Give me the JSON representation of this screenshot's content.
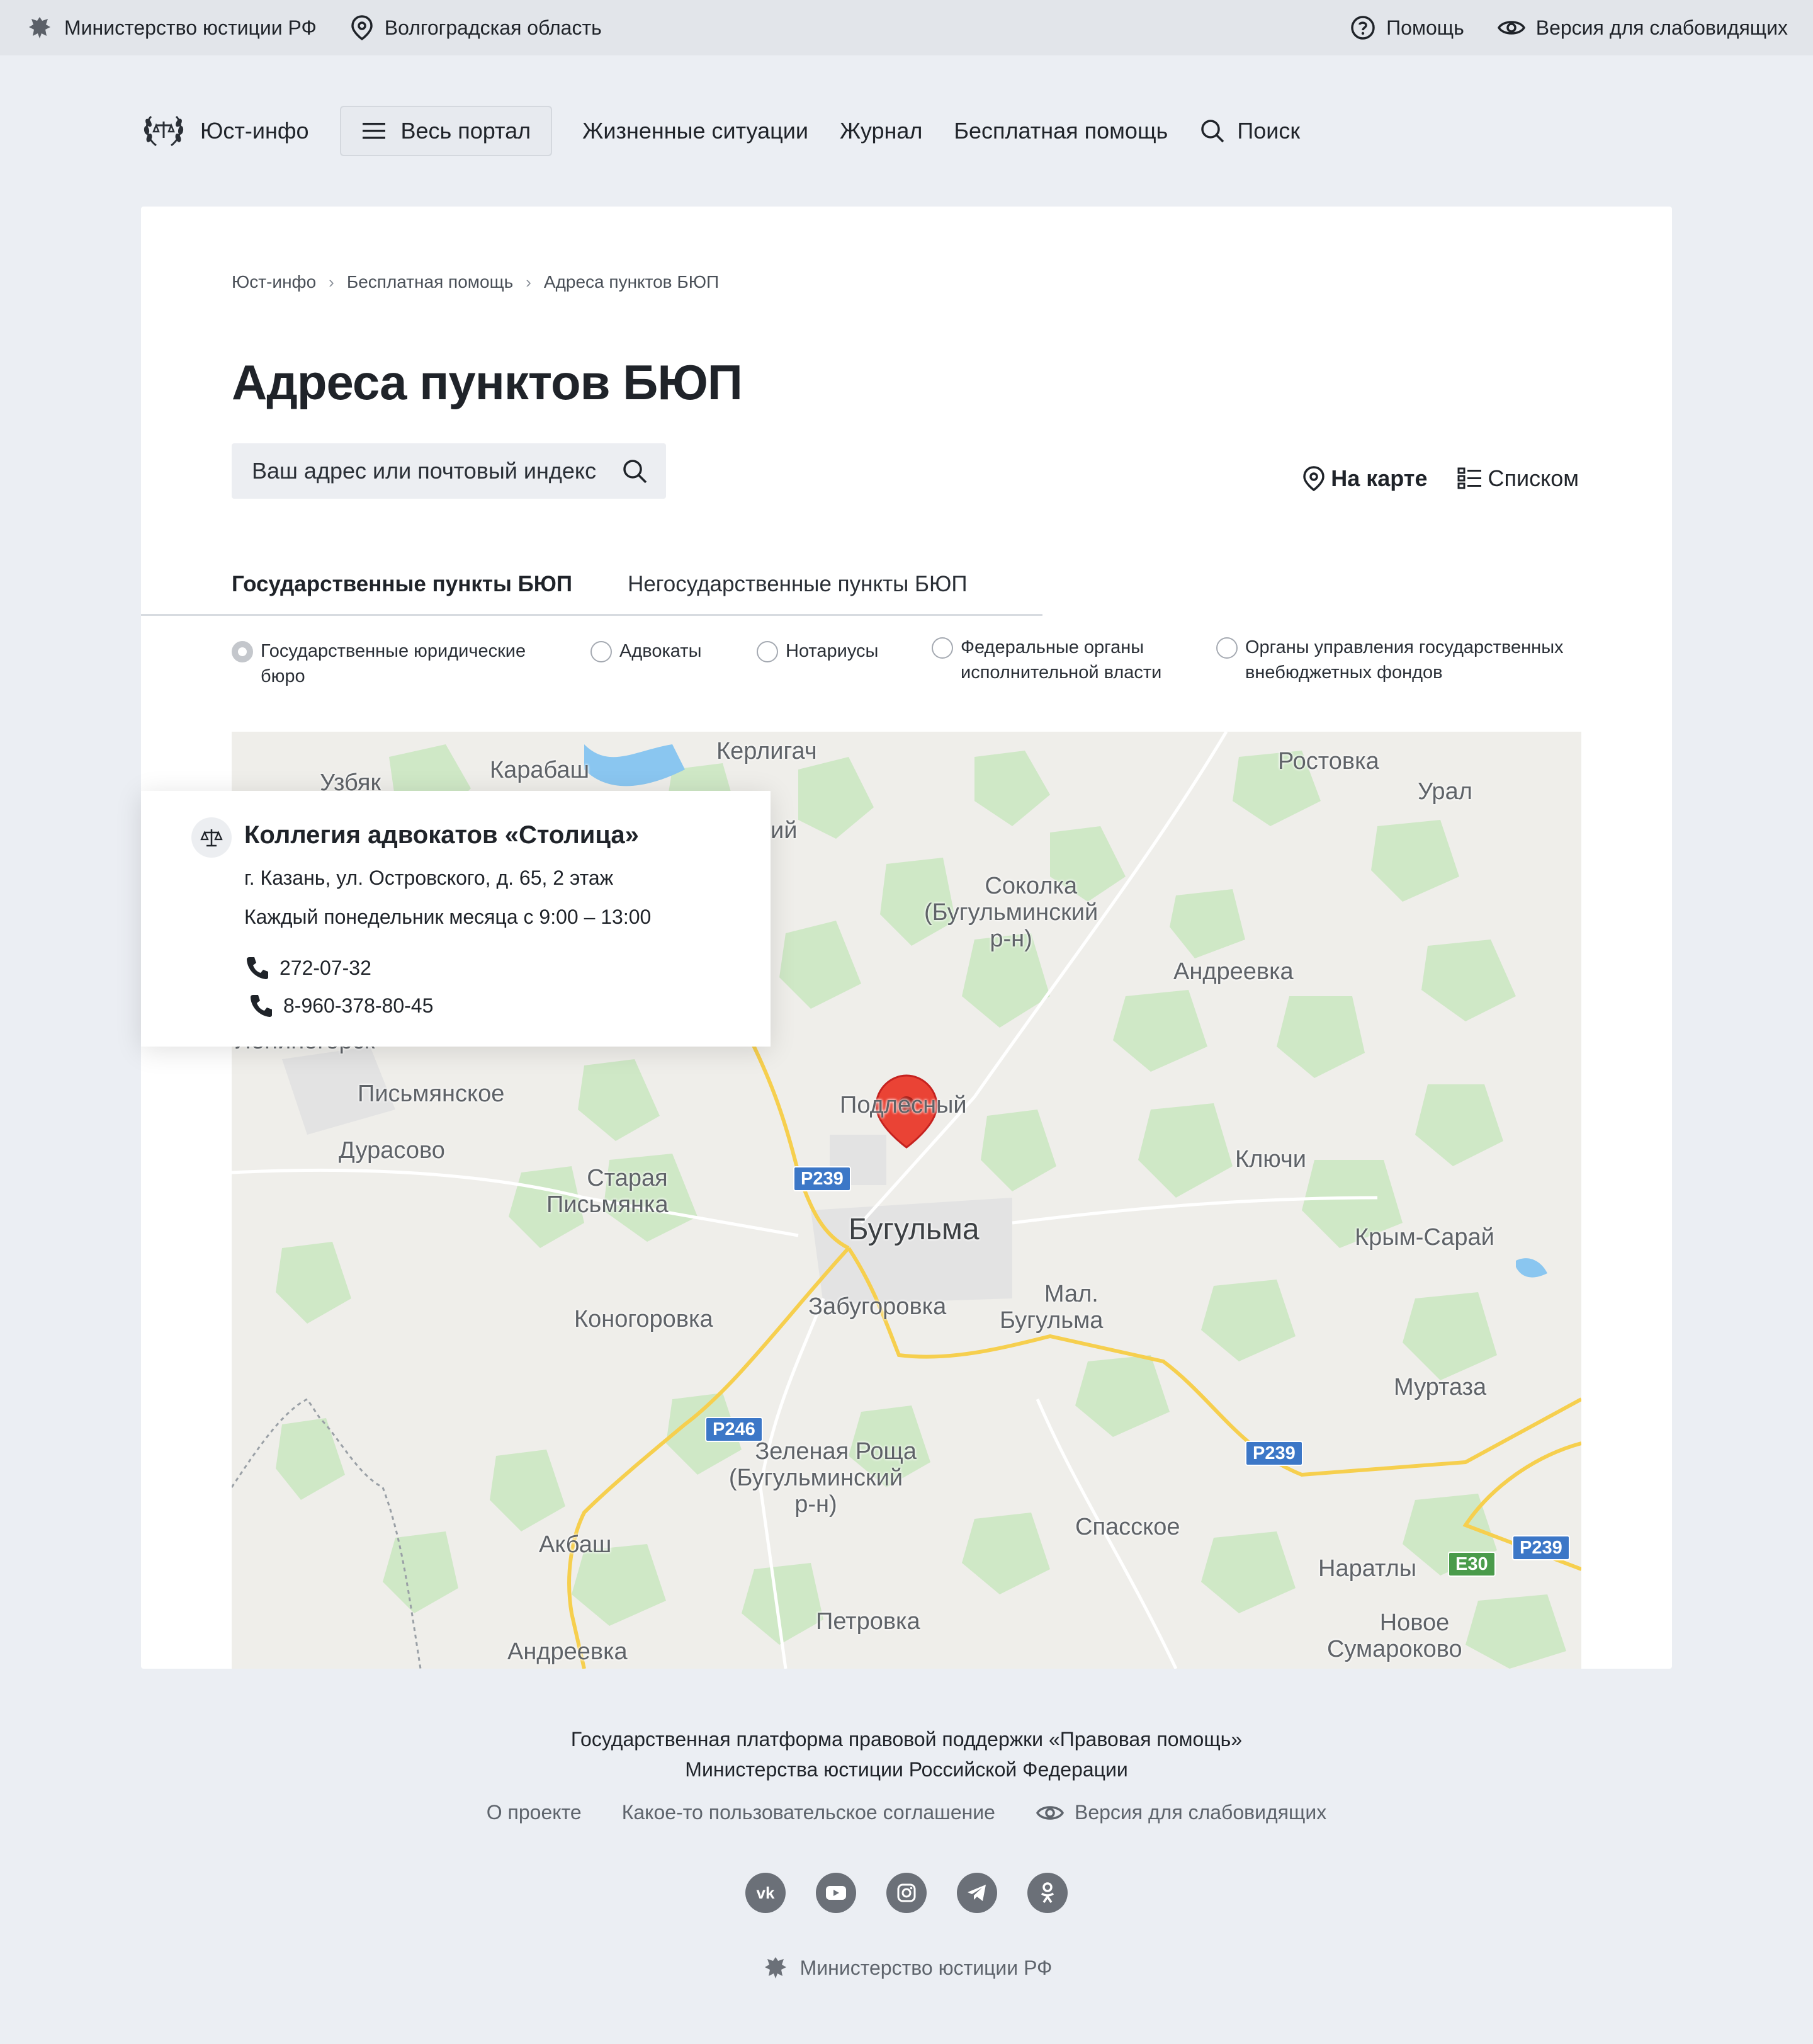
{
  "topbar": {
    "ministry": "Министерство юстиции РФ",
    "region": "Волгоградская область",
    "help": "Помощь",
    "accessibility": "Версия для слабовидящих"
  },
  "nav": {
    "logo": "Юст-инфо",
    "menu": "Весь портал",
    "links": [
      "Жизненные ситуации",
      "Журнал",
      "Бесплатная помощь"
    ],
    "search": "Поиск"
  },
  "breadcrumb": [
    "Юст-инфо",
    "Бесплатная помощь",
    "Адреса пунктов БЮП"
  ],
  "page_title": "Адреса пунктов БЮП",
  "search": {
    "placeholder": "Ваш адрес или почтовый индекс"
  },
  "view_switch": {
    "map": "На карте",
    "list": "Списком"
  },
  "tabs": [
    {
      "label": "Государственные пункты БЮП",
      "active": true
    },
    {
      "label": "Негосударственные пункты БЮП",
      "active": false
    }
  ],
  "filters": [
    {
      "label": "Государственные юридические бюро",
      "selected": true
    },
    {
      "label": "Адвокаты",
      "selected": false
    },
    {
      "label": "Нотариусы",
      "selected": false
    },
    {
      "label": "Федеральные органы исполнительной власти",
      "selected": false
    },
    {
      "label": "Органы управления государственных внебюджетных фондов",
      "selected": false
    }
  ],
  "popup": {
    "name": "Коллегия адвокатов «Столица»",
    "address": "г. Казань, ул. Островского, д. 65, 2 этаж",
    "schedule": "Каждый понедельник месяца с 9:00 – 13:00",
    "phones": [
      "272-07-32",
      "8-960-378-80-45"
    ]
  },
  "map": {
    "places": {
      "uzbyak": "Узбяк",
      "karabash": "Карабаш",
      "kerligach": "Керлигач",
      "rostovka": "Ростовка",
      "ural": "Урал",
      "sokolka": "Соколка\n(Бугульминский\nр-н)",
      "andreevka1": "Андреевка",
      "fragment": "ий",
      "leninogorsk": "Лениногорск",
      "pismyanskoe": "Письмянское",
      "podlesny": "Подлесный",
      "durasovo": "Дурасово",
      "staraya": "Старая\nПисьмянка",
      "klyuchi": "Ключи",
      "bugulma": "Бугульма",
      "krym": "Крым-Сарай",
      "mal": "Мал.\nБугульма",
      "zabugorovka": "Забугоровка",
      "konogorovka": "Коногоровка",
      "murtaza": "Муртаза",
      "zelenaya": "Зеленая Роща\n(Бугульминский\nр-н)",
      "akbash": "Акбаш",
      "spasskoe": "Спасское",
      "naratly": "Наратлы",
      "novoe": "Новое\nСумароково",
      "petrovka": "Петровка",
      "andreevka2": "Андреевка"
    },
    "shields": {
      "r239a": "Р239",
      "r246": "Р246",
      "r239b": "Р239",
      "r239c": "Р239",
      "e30": "E30"
    }
  },
  "footer": {
    "line1": "Государственная платформа правовой поддержки «Правовая помощь»",
    "line2": "Министерства юстиции Российской Федерации",
    "links": [
      "О проекте",
      "Какое-то пользовательское соглашение",
      "Версия для слабовидящих"
    ],
    "social": [
      "vk",
      "youtube",
      "instagram",
      "telegram",
      "odnoklassniki"
    ],
    "brand": "Министерство юстиции РФ"
  },
  "colors": {
    "accent": "#1f2329",
    "page_bg": "#ebeef3",
    "marker": "#ea4335"
  }
}
